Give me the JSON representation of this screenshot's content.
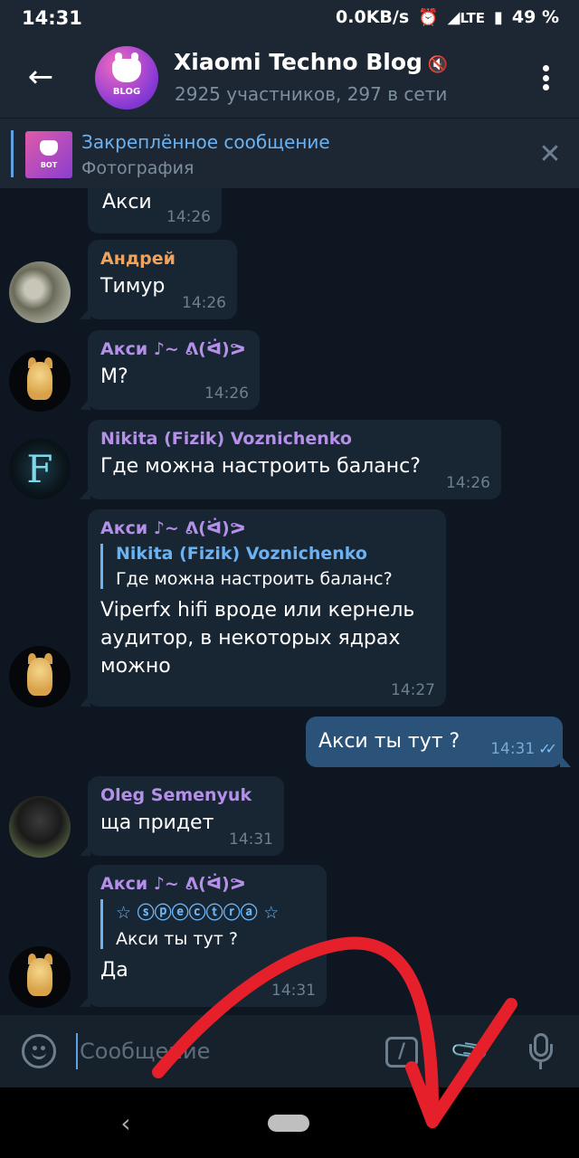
{
  "status_bar": {
    "time": "14:31",
    "speed": "0.0KB/s",
    "network": "LTE",
    "battery": "49 %"
  },
  "header": {
    "title": "Xiaomi Techno Blog",
    "subtitle": "2925 участников, 297 в сети",
    "avatar_text": "BLOG"
  },
  "pinned": {
    "title": "Закреплённое сообщение",
    "subtitle": "Фотография",
    "thumb_text": "BOT"
  },
  "messages": [
    {
      "sender": "",
      "text": "Акси",
      "time": "14:26"
    },
    {
      "sender": "Андрей",
      "sender_color": "#f0a35c",
      "text": "Тимур",
      "time": "14:26"
    },
    {
      "sender": "Акси ♪~ ᕕ(ᐛ)ᕗ",
      "sender_color": "#b490e8",
      "text": "М?",
      "time": "14:26"
    },
    {
      "sender": "Nikita (Fizik) Voznichenko",
      "sender_color": "#b490e8",
      "text": "Где можна настроить баланс?",
      "time": "14:26",
      "avatar_letter": "F"
    },
    {
      "sender": "Акси ♪~ ᕕ(ᐛ)ᕗ",
      "sender_color": "#b490e8",
      "reply_name": "Nikita (Fizik) Voznichenko",
      "reply_text": "Где можна настроить баланс?",
      "text_lines": [
        "Viperfx hifi вроде или кернель",
        "аудитор, в некоторых ядрах",
        "можно"
      ],
      "time": "14:27"
    },
    {
      "outgoing": true,
      "text": "Акси ты тут ?",
      "time": "14:31"
    },
    {
      "sender": "Oleg Semenyuk",
      "sender_color": "#b490e8",
      "text": "ща придет",
      "time": "14:31"
    },
    {
      "sender": "Акси ♪~ ᕕ(ᐛ)ᕗ",
      "sender_color": "#b490e8",
      "reply_name": "☆ ⓢⓟⓔⓒⓣⓡⓐ ☆",
      "reply_text": "Акси ты тут ?",
      "text": "Да",
      "time": "14:31"
    }
  ],
  "input": {
    "placeholder": "Сообщение",
    "command_icon": "/"
  },
  "icons": {
    "back": "arrow-left-icon",
    "menu": "more-vertical-icon",
    "mute": "mute-icon",
    "close": "close-icon",
    "emoji": "smile-icon",
    "command": "slash-command-icon",
    "attach": "paperclip-icon",
    "mic": "microphone-icon",
    "read": "double-check-icon"
  },
  "colors": {
    "header_bg": "#1d2733",
    "chat_bg": "#0e1621",
    "bubble_in": "#182533",
    "bubble_out": "#2b5278",
    "accent": "#6ab2f2",
    "annotation_arrow": "#e5202b"
  }
}
